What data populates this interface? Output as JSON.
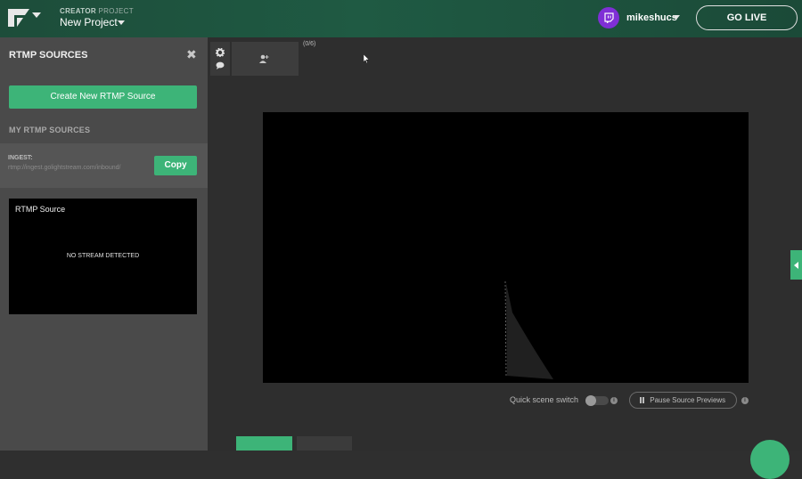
{
  "header": {
    "project_label_bold": "CREATOR",
    "project_label_rest": " PROJECT",
    "project_name": "New Project",
    "username": "mikeshucs",
    "go_live_label": "GO LIVE"
  },
  "sidebar": {
    "title": "RTMP SOURCES",
    "create_button": "Create New RTMP Source",
    "section_title": "MY RTMP SOURCES",
    "ingest_label": "INGEST:",
    "ingest_url": "rtmp://ingest.golightstream.com/inbound/",
    "copy_button": "Copy",
    "sources": [
      {
        "name": "RTMP Source",
        "status": "NO STREAM DETECTED"
      }
    ]
  },
  "scenes": {
    "count": "(0/6)"
  },
  "preview_controls": {
    "quick_scene_label": "Quick scene switch",
    "pause_label": "Pause Source Previews"
  },
  "colors": {
    "accent": "#3db478",
    "twitch": "#7f2fd6"
  }
}
